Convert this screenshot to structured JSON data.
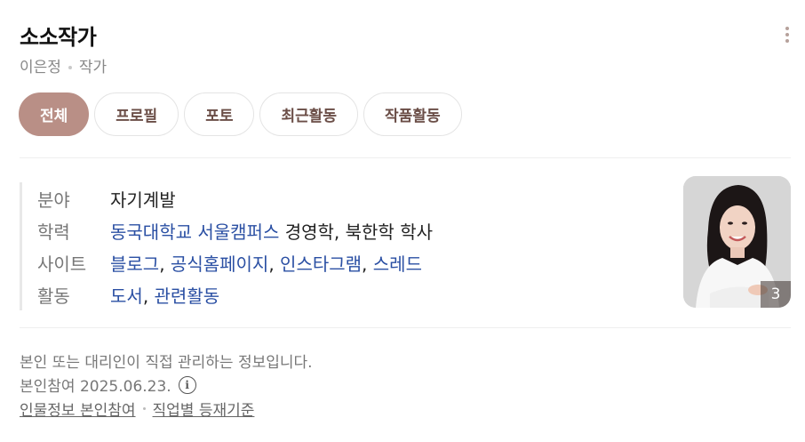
{
  "profile": {
    "name": "소소작가",
    "real_name": "이은정",
    "occupation": "작가",
    "more_icon": "more-vertical-icon"
  },
  "tabs": [
    {
      "label": "전체",
      "active": true
    },
    {
      "label": "프로필",
      "active": false
    },
    {
      "label": "포토",
      "active": false
    },
    {
      "label": "최근활동",
      "active": false
    },
    {
      "label": "작품활동",
      "active": false
    }
  ],
  "info": {
    "field": {
      "label": "분야",
      "value": "자기계발"
    },
    "education": {
      "label": "학력",
      "school": "동국대학교 서울캠퍼스",
      "degree": "경영학, 북한학 학사"
    },
    "sites": {
      "label": "사이트",
      "items": [
        "블로그",
        "공식홈페이지",
        "인스타그램",
        "스레드"
      ]
    },
    "activity": {
      "label": "활동",
      "items": [
        "도서",
        "관련활동"
      ]
    }
  },
  "photo": {
    "count": "3"
  },
  "footer": {
    "notice": "본인 또는 대리인이 직접 관리하는 정보입니다.",
    "participation": "본인참여 2025.06.23.",
    "links": [
      "인물정보 본인참여",
      "직업별 등재기준"
    ]
  },
  "colors": {
    "accent": "#b98f86",
    "link": "#2a4fa3"
  }
}
